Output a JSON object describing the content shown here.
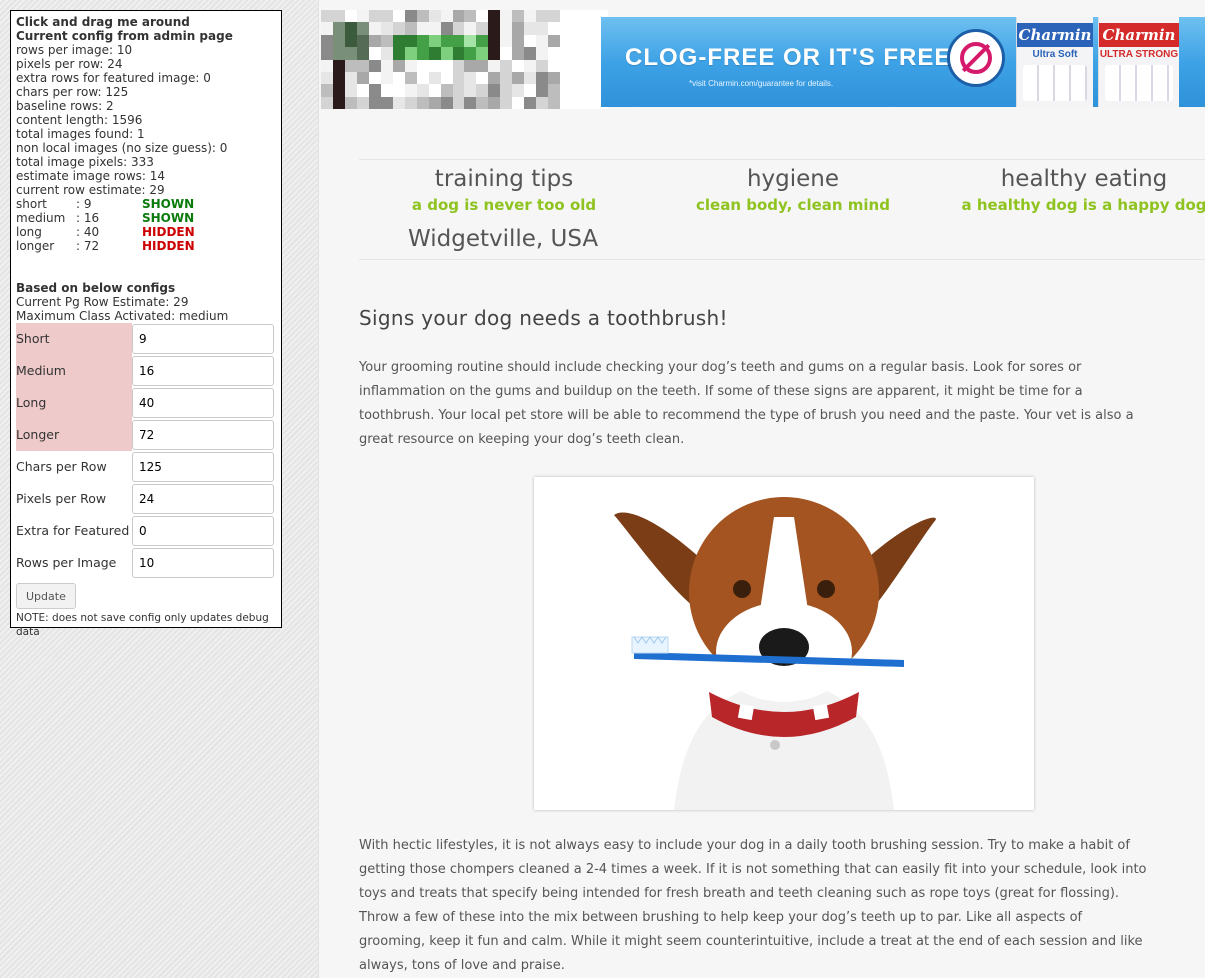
{
  "debug": {
    "title_drag": "Click and drag me around",
    "title_config": "Current config from admin page",
    "stats": [
      "rows per image: 10",
      "pixels per row: 24",
      "extra rows for featured image: 0",
      "chars per row: 125",
      "baseline rows: 2",
      "content length: 1596",
      "total images found: 1",
      "non local images (no size guess): 0",
      "total image pixels: 333",
      "estimate image rows: 14",
      "current row estimate: 29"
    ],
    "classes": [
      {
        "name": "short",
        "value": ": 9",
        "status": "SHOWN"
      },
      {
        "name": "medium",
        "value": ": 16",
        "status": "SHOWN"
      },
      {
        "name": "long",
        "value": ": 40",
        "status": "HIDDEN"
      },
      {
        "name": "longer",
        "value": ": 72",
        "status": "HIDDEN"
      }
    ],
    "based_on": "Based on below configs",
    "row_estimate": "Current Pg Row Estimate: 29",
    "max_class": "Maximum Class Activated: medium",
    "fields": [
      {
        "label": "Short",
        "value": "9"
      },
      {
        "label": "Medium",
        "value": "16"
      },
      {
        "label": "Long",
        "value": "40"
      },
      {
        "label": "Longer",
        "value": "72"
      },
      {
        "label": "Chars per Row",
        "value": "125"
      },
      {
        "label": "Pixels per Row",
        "value": "24"
      },
      {
        "label": "Extra for Featured",
        "value": "0"
      },
      {
        "label": "Rows per Image",
        "value": "10"
      }
    ],
    "update_label": "Update",
    "note": "NOTE: does not save config only updates debug data"
  },
  "ad": {
    "headline": "CLOG-FREE OR IT'S FREE.*",
    "fine_print": "*visit Charmin.com/guarantee for details.",
    "brand1": "Charmin",
    "brand1_sub": "Ultra Soft",
    "brand2": "Charmin",
    "brand2_sub": "ULTRA STRONG"
  },
  "nav": {
    "items": [
      {
        "title": "training tips",
        "subtitle": "a dog is never too old"
      },
      {
        "title": "hygiene",
        "subtitle": "clean body, clean mind"
      },
      {
        "title": "healthy eating",
        "subtitle": "a healthy dog is a happy dog"
      }
    ],
    "location": "Widgetville, USA"
  },
  "article": {
    "title": "Signs your dog needs a toothbrush!",
    "p1": "Your grooming routine should include checking your dog’s teeth and gums on a regular basis. Look for sores or inflammation on the gums and buildup on the teeth. If some of these signs are apparent, it might be time for a toothbrush. Your local pet store will be able to recommend the type of brush you need and the paste. Your vet is also a great resource on keeping your dog’s teeth clean.",
    "p2": "With hectic lifestyles, it is not always easy to include your dog in a daily tooth brushing session. Try to make a habit of getting those chompers cleaned a 2-4 times a week. If it is not something that can easily fit into your schedule, look into toys and treats that specify being intended for fresh breath and teeth cleaning such as rope toys (great for flossing). Throw a few of these into the mix between brushing to help keep your dog’s teeth up to par. Like all aspects of grooming, keep it fun and calm. While it might seem counterintuitive, include a treat at the end of each session and like always, tons of love and praise."
  },
  "colors": {
    "shown": "#0a7a0a",
    "hidden": "#cc0000",
    "nav_subtitle": "#8fc31f",
    "highlight_label": "#eecaca",
    "ad_blue": "#3ea2e6"
  },
  "icons": {
    "logo": "pixelated-logo",
    "photo": "dog-with-toothbrush-photo"
  }
}
